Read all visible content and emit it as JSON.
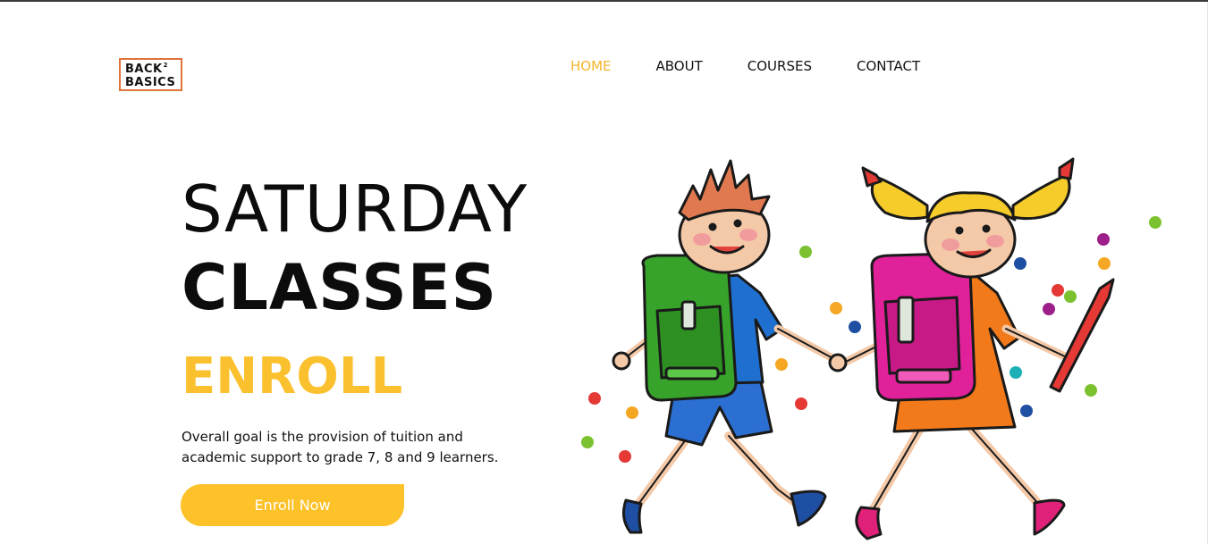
{
  "brand": {
    "logo_line1": "BACK",
    "logo_sup": "2",
    "logo_line2": "BASICS"
  },
  "nav": {
    "items": [
      {
        "label": "HOME",
        "active": true
      },
      {
        "label": "ABOUT",
        "active": false
      },
      {
        "label": "COURSES",
        "active": false
      },
      {
        "label": "CONTACT",
        "active": false
      }
    ]
  },
  "hero": {
    "title_line1": "SATURDAY",
    "title_line2": "CLASSES",
    "subtitle": "ENROLL",
    "description": "Overall goal is the provision of tuition and academic support to grade 7, 8 and 9 learners.",
    "cta_label": "Enroll Now"
  },
  "colors": {
    "accent": "#fbc02d",
    "logo_border": "#e0733a",
    "text": "#0c0c0c"
  },
  "illustration": {
    "icon": "kids-with-backpacks-illustration"
  }
}
